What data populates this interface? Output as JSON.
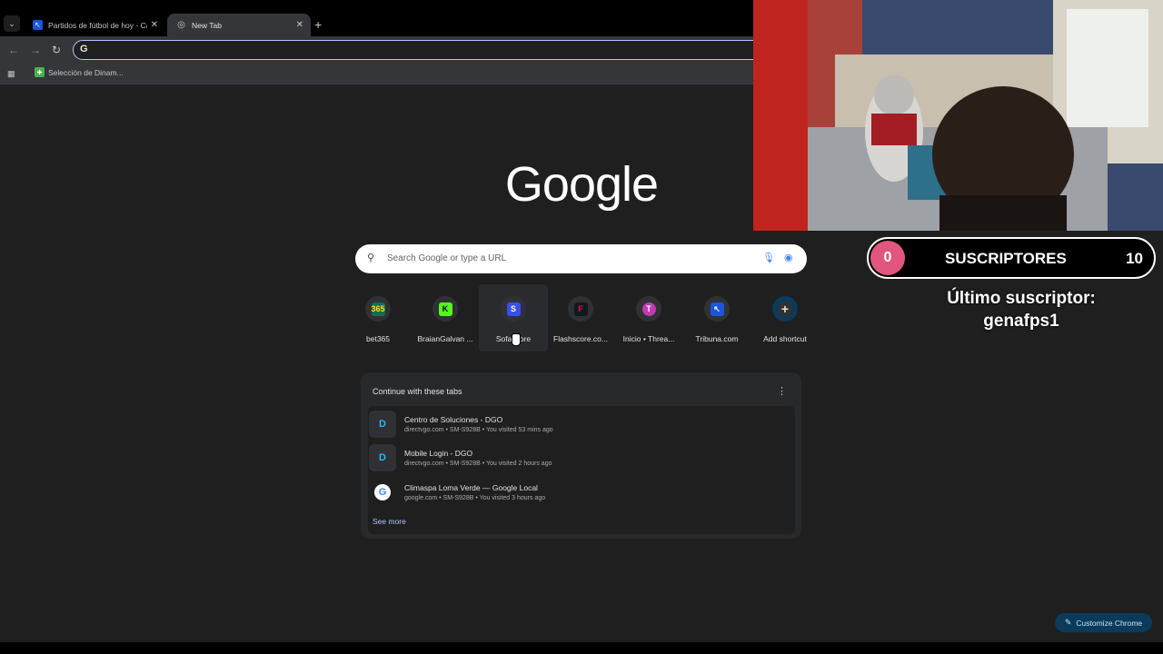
{
  "tabs": [
    {
      "title": "Partidos de fútbol de hoy - Cal",
      "active": false
    },
    {
      "title": "New Tab",
      "active": true
    }
  ],
  "bookmarks": [
    {
      "label": "Selección de Dinam..."
    }
  ],
  "logo": "Google",
  "search": {
    "placeholder": "Search Google or type a URL"
  },
  "shortcuts": [
    {
      "label": "bet365",
      "icon": "bet365-icon",
      "icon_text": "365",
      "color": "#126e51",
      "fg": "#ffdf1b"
    },
    {
      "label": "BraianGalvan ...",
      "icon": "kick-icon",
      "icon_text": "K",
      "color": "#53fc18",
      "fg": "#000000"
    },
    {
      "label": "Sofascore",
      "icon": "sofascore-icon",
      "icon_text": "S",
      "color": "#374df5",
      "fg": "#ffffff"
    },
    {
      "label": "Flashscore.co...",
      "icon": "flashscore-icon",
      "icon_text": "F",
      "color": "#0f1921",
      "fg": "#ff0046"
    },
    {
      "label": "Inicio • Threa...",
      "icon": "threads-icon",
      "icon_text": "T",
      "color": "#c13ab2",
      "fg": "#ffffff"
    },
    {
      "label": "Tribuna.com",
      "icon": "tribuna-icon",
      "icon_text": "↖",
      "color": "#1a56db",
      "fg": "#ffffff"
    },
    {
      "label": "Add shortcut",
      "icon": "plus-icon",
      "icon_text": "+",
      "color": "#303134",
      "fg": "#e3e3e3"
    }
  ],
  "continue_card": {
    "title": "Continue with these tabs",
    "items": [
      {
        "title": "Centro de Soluciones - DGO",
        "sub": "directvgo.com • SM-S928B • You visited 53 mins ago",
        "icon": "dgo-icon",
        "icon_text": "D"
      },
      {
        "title": "Mobile Login - DGO",
        "sub": "directvgo.com • SM-S928B • You visited 2 hours ago",
        "icon": "dgo-icon",
        "icon_text": "D"
      },
      {
        "title": "Climaspa Loma Verde — Google Local",
        "sub": "google.com • SM-S928B • You visited 3 hours ago",
        "icon": "google-icon",
        "icon_text": "G"
      }
    ],
    "see_more": "See more"
  },
  "customize": {
    "label": "Customize Chrome"
  },
  "overlay": {
    "subs_current": "0",
    "subs_label": "SUSCRIPTORES",
    "subs_goal": "10",
    "last_sub_label": "Último suscriptor:",
    "last_sub_name": "genafps1"
  },
  "colors": {
    "accent": "#a8c7fa",
    "background": "#1f1f1f",
    "sub_badge": "#e2557e"
  }
}
